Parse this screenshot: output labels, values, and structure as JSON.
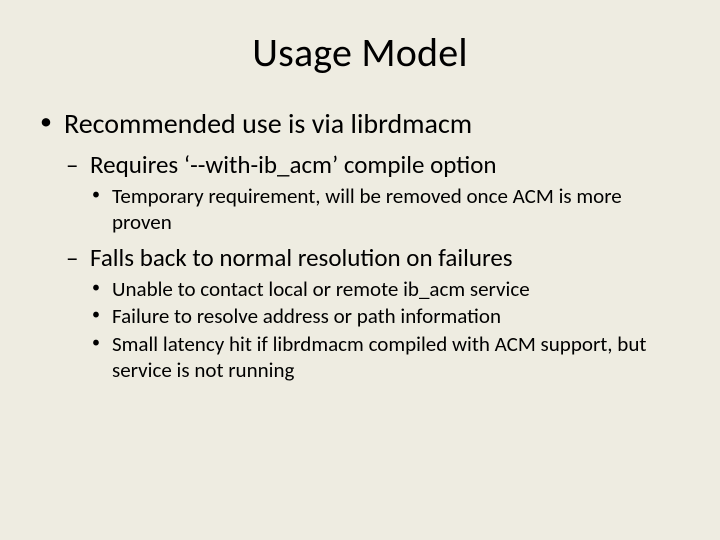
{
  "title": "Usage Model",
  "bullets": {
    "b1": "Recommended use is via librdmacm",
    "b1_1": "Requires ‘--with-ib_acm’ compile option",
    "b1_1_1": "Temporary requirement, will be removed once ACM is more proven",
    "b1_2": "Falls back to normal resolution on failures",
    "b1_2_1": "Unable to contact local or remote ib_acm service",
    "b1_2_2": "Failure to resolve address or path information",
    "b1_2_3": "Small latency hit if librdmacm compiled with ACM support, but service is not running"
  }
}
